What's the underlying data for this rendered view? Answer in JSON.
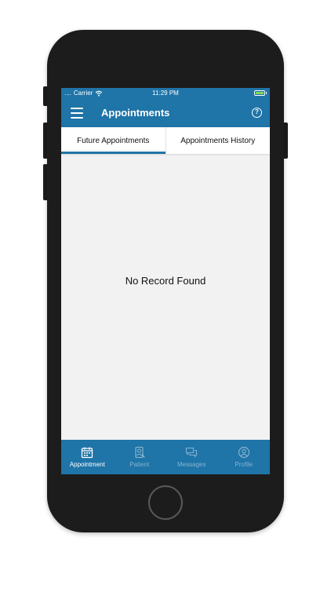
{
  "status_bar": {
    "carrier": "Carrier",
    "signal": "....",
    "time": "11:29 PM"
  },
  "app_bar": {
    "title": "Appointments",
    "menu_icon": "hamburger-menu-icon",
    "help_icon": "help-circle-icon",
    "help_glyph": "?"
  },
  "tabs": [
    {
      "label": "Future Appointments",
      "active": true
    },
    {
      "label": "Appointments History",
      "active": false
    }
  ],
  "content": {
    "empty_message": "No Record Found"
  },
  "bottom_nav": [
    {
      "label": "Appointment",
      "icon": "calendar-icon",
      "active": true
    },
    {
      "label": "Patient",
      "icon": "patient-icon",
      "active": false
    },
    {
      "label": "Messages",
      "icon": "messages-icon",
      "active": false
    },
    {
      "label": "Profile",
      "icon": "profile-icon",
      "active": false
    }
  ],
  "colors": {
    "brand": "#1f74a8",
    "background": "#f2f2f2",
    "device": "#1c1c1c"
  }
}
